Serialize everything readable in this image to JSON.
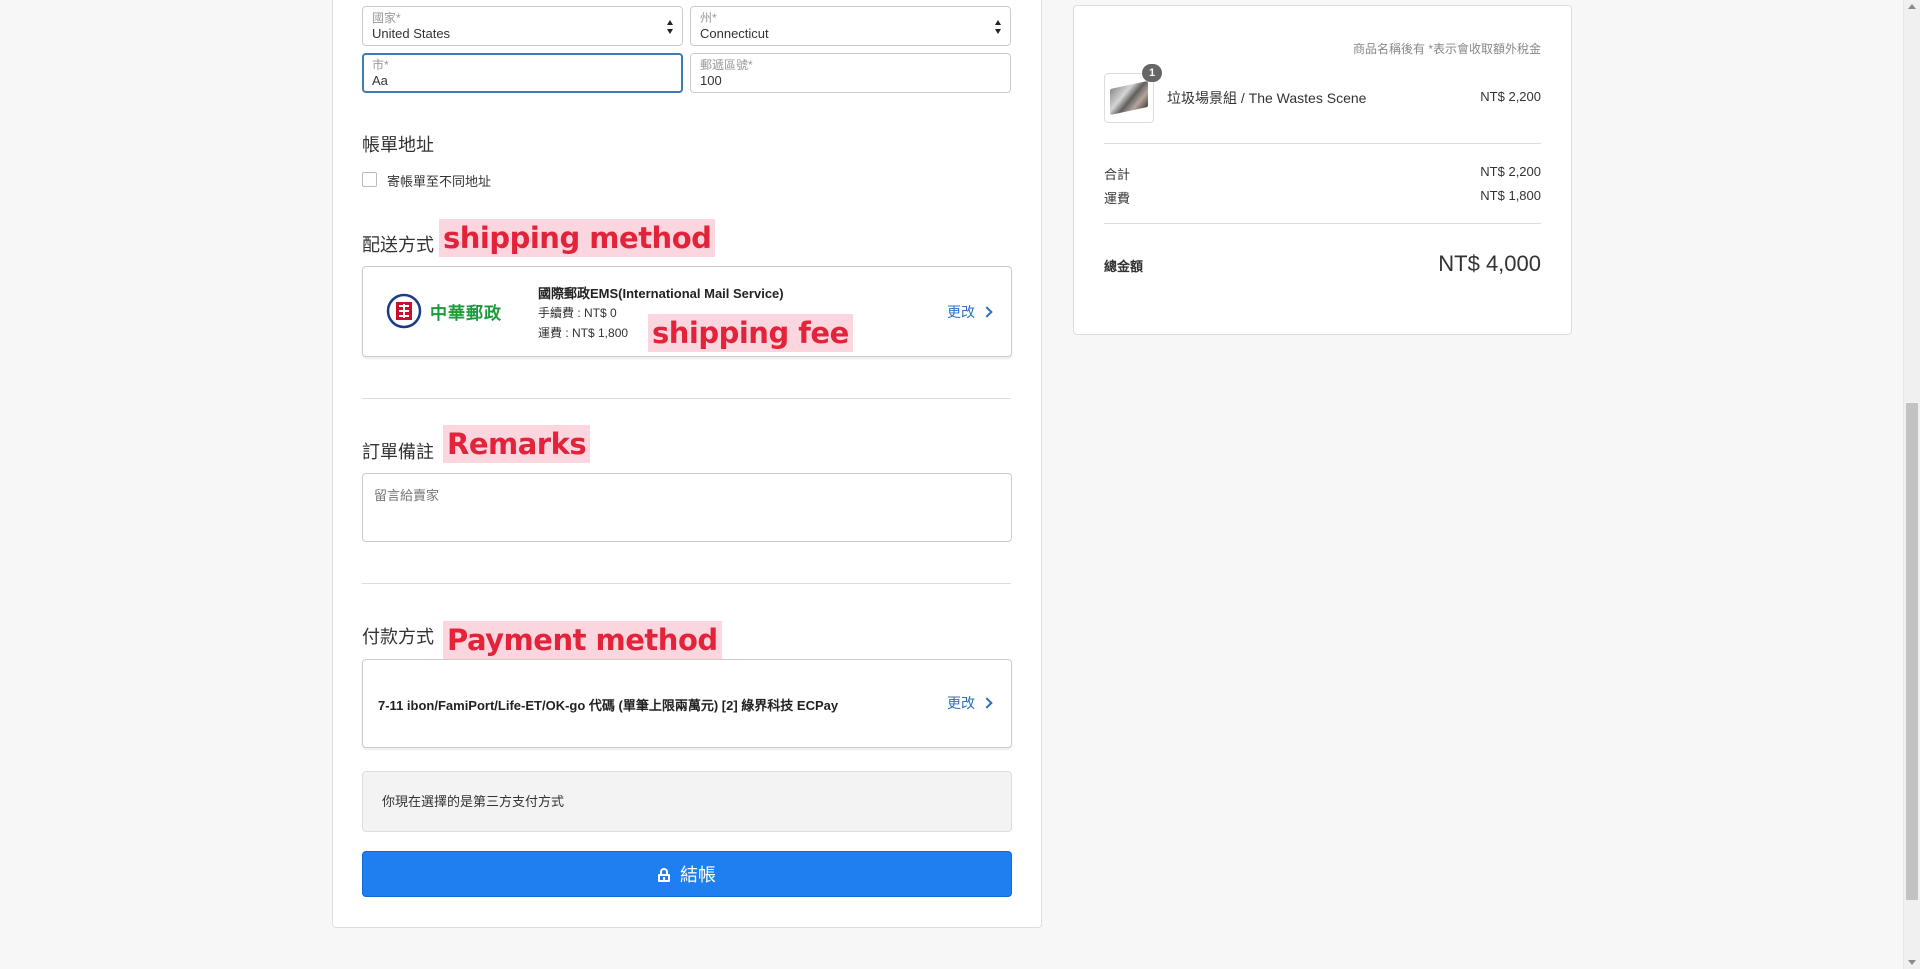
{
  "address": {
    "country_label": "國家*",
    "country_value": "United States",
    "state_label": "州*",
    "state_value": "Connecticut",
    "city_label": "市*",
    "city_value": "Aa",
    "zip_label": "郵遞區號*",
    "zip_value": "100"
  },
  "billing": {
    "title": "帳單地址",
    "checkbox_label": "寄帳單至不同地址"
  },
  "shipping": {
    "title": "配送方式",
    "annotation": "shipping method",
    "fee_annotation": "shipping fee",
    "logo_text": "中華郵政",
    "name": "國際郵政EMS(International Mail Service)",
    "handling_fee": "手續費 : NT$ 0",
    "shipping_fee": "運費 : NT$ 1,800",
    "change_label": "更改"
  },
  "remarks": {
    "title": "訂單備註",
    "annotation": "Remarks",
    "placeholder": "留言給賣家"
  },
  "payment": {
    "title": "付款方式",
    "annotation": "Payment method",
    "name": "7-11 ibon/FamiPort/Life-ET/OK-go 代碼 (單筆上限兩萬元) [2] 綠界科技 ECPay",
    "change_label": "更改",
    "note": "你現在選擇的是第三方支付方式"
  },
  "checkout_label": "結帳",
  "summary": {
    "tax_note": "商品名稱後有 *表示會收取額外稅金",
    "item": {
      "qty": "1",
      "name": "垃圾場景組 / The Wastes Scene",
      "price": "NT$ 2,200"
    },
    "subtotal_label": "合計",
    "subtotal_value": "NT$ 2,200",
    "shipping_label": "運費",
    "shipping_value": "NT$ 1,800",
    "total_label": "總金額",
    "total_value": "NT$ 4,000"
  },
  "colors": {
    "primary": "#1f7ff0",
    "link": "#2c6fbd",
    "annotation_bg": "#fbd6df",
    "annotation_text": "#e2233a",
    "post_logo_red": "#c8102e",
    "post_logo_green": "#1d9a3a"
  }
}
